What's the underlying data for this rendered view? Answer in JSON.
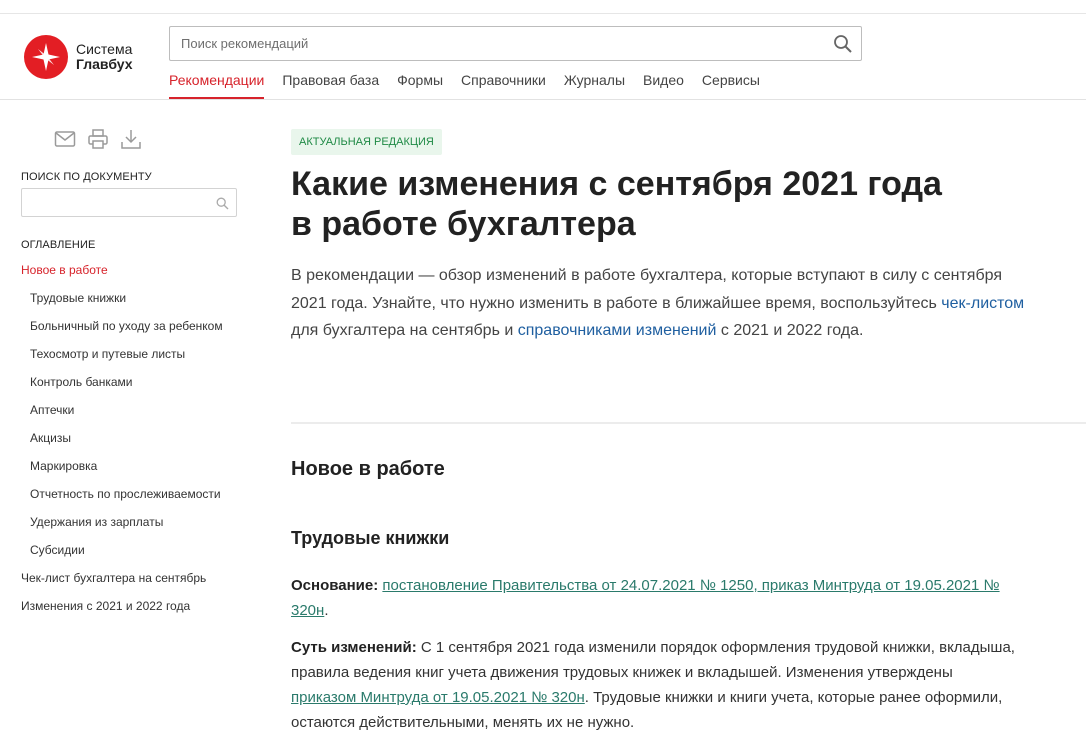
{
  "header": {
    "logo_line1": "Система",
    "logo_line2": "Главбух",
    "search_placeholder": "Поиск рекомендаций",
    "nav": [
      "Рекомендации",
      "Правовая база",
      "Формы",
      "Справочники",
      "Журналы",
      "Видео",
      "Сервисы"
    ],
    "active_nav": "Рекомендации"
  },
  "sidebar": {
    "tools": [
      "mail-icon",
      "printer-icon",
      "download-icon"
    ],
    "search_label": "ПОИСК ПО ДОКУМЕНТУ",
    "toc_label": "ОГЛАВЛЕНИЕ",
    "toc": [
      {
        "label": "Новое в работе",
        "active": true,
        "level": 0
      },
      {
        "label": "Трудовые книжки",
        "level": 1
      },
      {
        "label": "Больничный по уходу за ребенком",
        "level": 1
      },
      {
        "label": "Техосмотр и путевые листы",
        "level": 1
      },
      {
        "label": "Контроль банками",
        "level": 1
      },
      {
        "label": "Аптечки",
        "level": 1
      },
      {
        "label": "Акцизы",
        "level": 1
      },
      {
        "label": "Маркировка",
        "level": 1
      },
      {
        "label": "Отчетность по прослеживаемости",
        "level": 1
      },
      {
        "label": "Удержания из зарплаты",
        "level": 1
      },
      {
        "label": "Субсидии",
        "level": 1
      },
      {
        "label": "Чек-лист бухгалтера на сентябрь",
        "level": 0
      },
      {
        "label": "Изменения с 2021 и 2022 года",
        "level": 0
      }
    ]
  },
  "article": {
    "badge": "АКТУАЛЬНАЯ РЕДАКЦИЯ",
    "title_line1": "Какие изменения с сентября 2021 года",
    "title_line2": "в работе бухгалтера",
    "lead_part1": "В рекомендации — обзор изменений в работе бухгалтера, которые вступают в силу с сентября 2021 года. Узнайте, что нужно изменить в работе в ближайшее время, воспользуйтесь ",
    "lead_link1": "чек-листом",
    "lead_part2": " для бухгалтера на сентябрь и ",
    "lead_link2": "справочниками изменений",
    "lead_part3": " с 2021 и 2022 года.",
    "section_title": "Новое в работе",
    "subsection_title": "Трудовые книжки",
    "basis_label": "Основание:",
    "basis_link": "постановление Правительства от 24.07.2021 № 1250, приказ Минтруда от 19.05.2021 № 320н",
    "basis_end": ".",
    "changes_label": "Суть изменений:",
    "changes_part1": " С 1 сентября 2021 года изменили порядок оформления трудовой книжки, вкладыша, правила ведения книг учета движения трудовых книжек и вкладышей. Изменения утверждены ",
    "changes_link": "приказом Минтруда от 19.05.2021 № 320н",
    "changes_part2": ". Трудовые книжки и книги учета, которые ранее оформили, остаются действительными, менять их не нужно."
  },
  "colors": {
    "accent": "#d7232b",
    "badge_bg": "#e9f6ec",
    "badge_text": "#1f8a45",
    "lead_link": "#1f5fa0",
    "doc_link": "#2a7a6b"
  }
}
